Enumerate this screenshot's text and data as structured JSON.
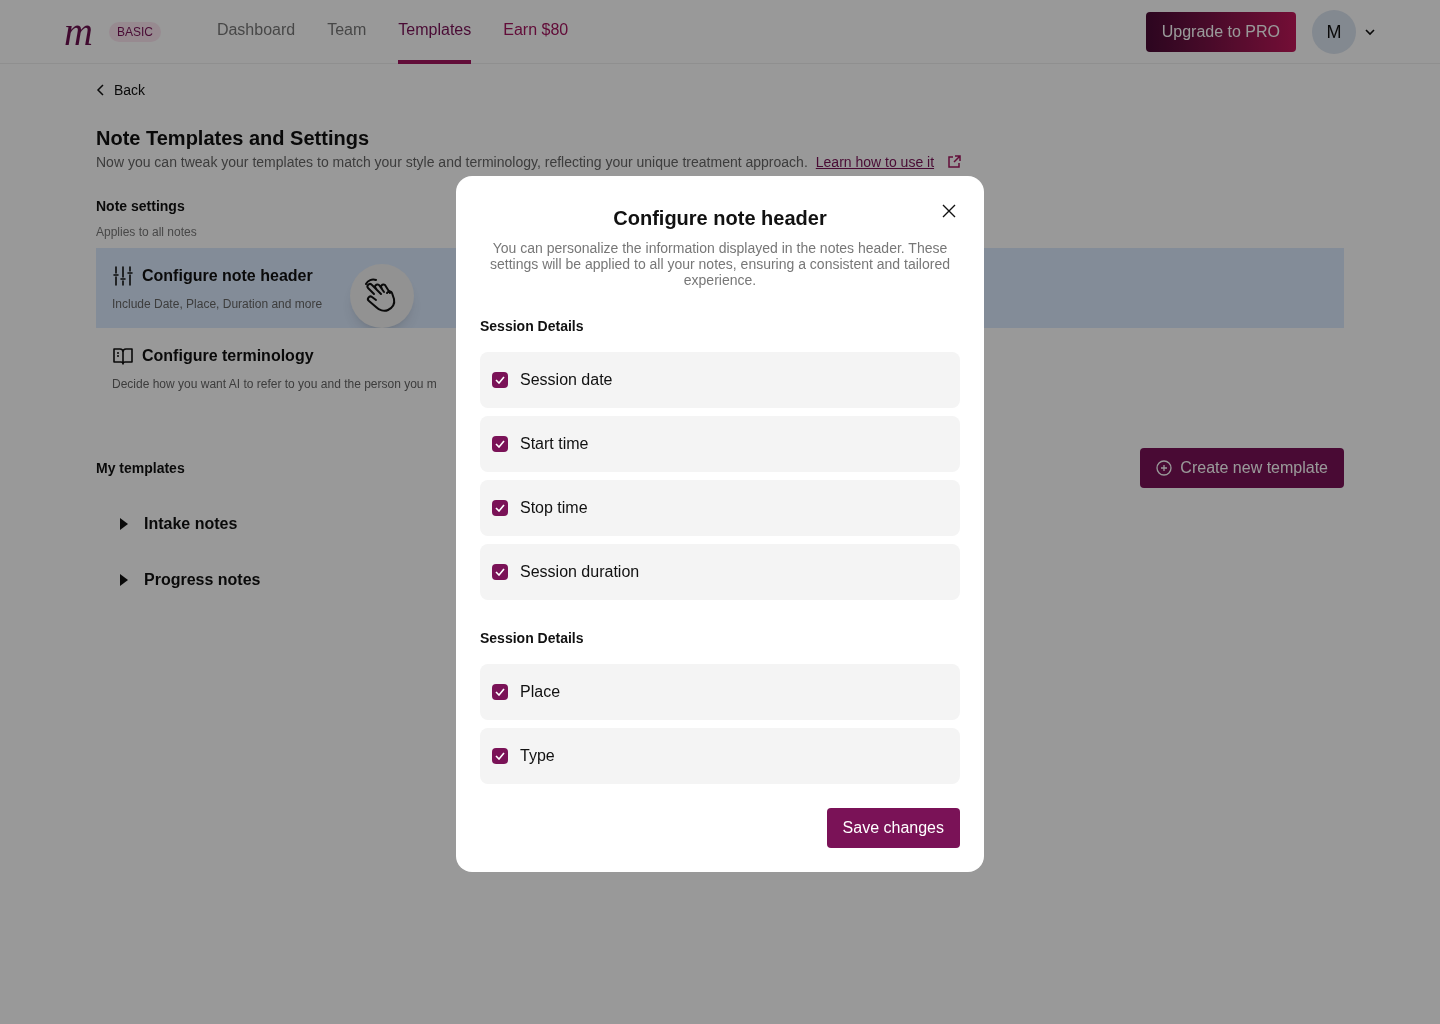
{
  "nav": {
    "logo": "m",
    "plan_badge": "BASIC",
    "tabs": [
      {
        "label": "Dashboard",
        "selected": false,
        "kind": "plain"
      },
      {
        "label": "Team",
        "selected": false,
        "kind": "plain"
      },
      {
        "label": "Templates",
        "selected": true,
        "kind": "plain"
      },
      {
        "label": "Earn $80",
        "selected": false,
        "kind": "promo"
      }
    ],
    "upgrade_button": "Upgrade to PRO",
    "avatar": "M"
  },
  "back": "Back",
  "page": {
    "title": "Note Templates and Settings",
    "description": "Now you can tweak your templates to match your style and terminology, reflecting your unique treatment approach.",
    "link": "Learn how to use it"
  },
  "note_settings": {
    "title": "Note settings",
    "subtitle": "Applies to all notes",
    "items": [
      {
        "kind": "sliders",
        "title": "Configure note header",
        "description": "Include Date, Place, Duration and more",
        "selected": true
      },
      {
        "kind": "book",
        "title": "Configure terminology",
        "description": "Decide how you want AI to refer to you and the person you m",
        "selected": false
      }
    ]
  },
  "templates": {
    "title": "My templates",
    "create_button": "Create new template",
    "groups": [
      {
        "label": "Intake notes",
        "expanded": false
      },
      {
        "label": "Progress notes",
        "expanded": false
      }
    ]
  },
  "modal": {
    "title": "Configure note header",
    "description": "You can personalize the information displayed in the notes header. These settings will be applied to all your notes, ensuring a consistent and tailored experience.",
    "sections": [
      {
        "title": "Session Details",
        "options": [
          {
            "label": "Session date",
            "checked": true
          },
          {
            "label": "Start time",
            "checked": true
          },
          {
            "label": "Stop time",
            "checked": true
          },
          {
            "label": "Session duration",
            "checked": true
          }
        ]
      },
      {
        "title": "Session Details",
        "options": [
          {
            "label": "Place",
            "checked": true
          },
          {
            "label": "Type",
            "checked": true
          }
        ]
      }
    ],
    "save_button": "Save changes"
  }
}
